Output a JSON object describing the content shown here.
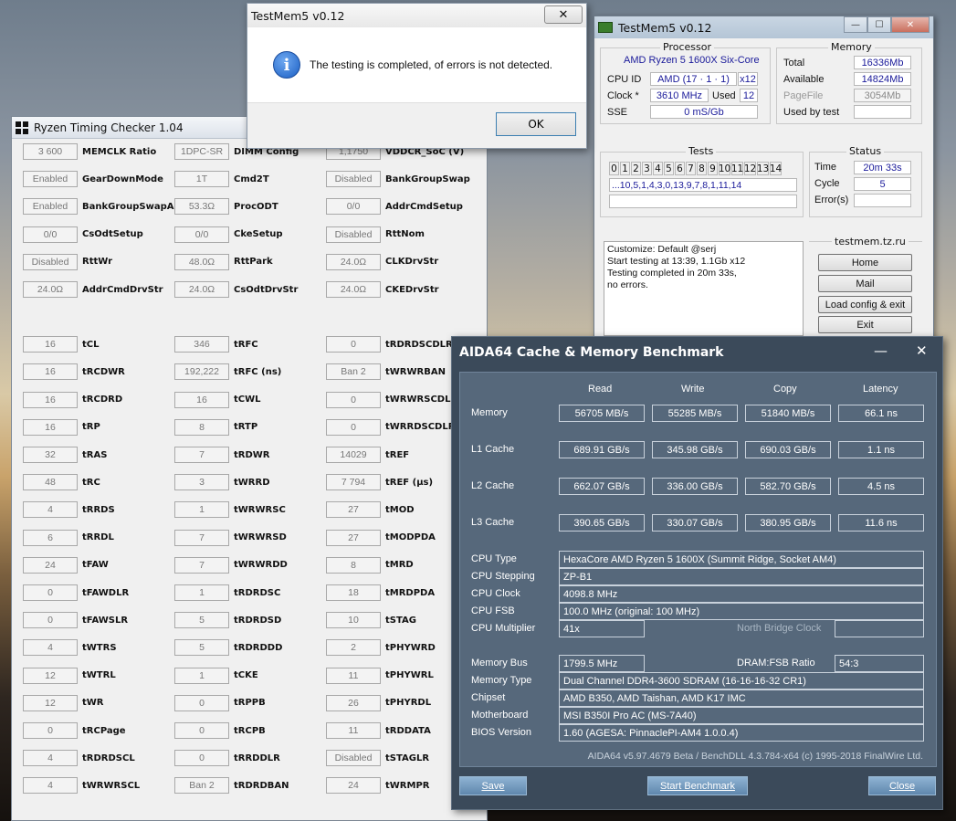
{
  "rtc": {
    "title": "Ryzen Timing Checker 1.04",
    "rows": [
      [
        [
          "3 600",
          "MEMCLK Ratio"
        ],
        [
          "1DPC-SR",
          "DIMM Config"
        ],
        [
          "1,1750",
          "VDDCR_SoC (V)"
        ]
      ],
      [
        [
          "Enabled",
          "GearDownMode"
        ],
        [
          "1T",
          "Cmd2T"
        ],
        [
          "Disabled",
          "BankGroupSwap"
        ]
      ],
      [
        [
          "Enabled",
          "BankGroupSwapAlt"
        ],
        [
          "53.3Ω",
          "ProcODT"
        ],
        [
          "0/0",
          "AddrCmdSetup"
        ]
      ],
      [
        [
          "0/0",
          "CsOdtSetup"
        ],
        [
          "0/0",
          "CkeSetup"
        ],
        [
          "Disabled",
          "RttNom"
        ]
      ],
      [
        [
          "Disabled",
          "RttWr"
        ],
        [
          "48.0Ω",
          "RttPark"
        ],
        [
          "24.0Ω",
          "CLKDrvStr"
        ]
      ],
      [
        [
          "24.0Ω",
          "AddrCmdDrvStr"
        ],
        [
          "24.0Ω",
          "CsOdtDrvStr"
        ],
        [
          "24.0Ω",
          "CKEDrvStr"
        ]
      ],
      [
        [
          "16",
          "tCL"
        ],
        [
          "346",
          "tRFC"
        ],
        [
          "0",
          "tRDRDSCDLR"
        ]
      ],
      [
        [
          "16",
          "tRCDWR"
        ],
        [
          "192,222",
          "tRFC (ns)"
        ],
        [
          "Ban 2",
          "tWRWRBAN"
        ]
      ],
      [
        [
          "16",
          "tRCDRD"
        ],
        [
          "16",
          "tCWL"
        ],
        [
          "0",
          "tWRWRSCDLR"
        ]
      ],
      [
        [
          "16",
          "tRP"
        ],
        [
          "8",
          "tRTP"
        ],
        [
          "0",
          "tWRRDSCDLR"
        ]
      ],
      [
        [
          "32",
          "tRAS"
        ],
        [
          "7",
          "tRDWR"
        ],
        [
          "14029",
          "tREF"
        ]
      ],
      [
        [
          "48",
          "tRC"
        ],
        [
          "3",
          "tWRRD"
        ],
        [
          "7 794",
          "tREF (µs)"
        ]
      ],
      [
        [
          "4",
          "tRRDS"
        ],
        [
          "1",
          "tWRWRSC"
        ],
        [
          "27",
          "tMOD"
        ]
      ],
      [
        [
          "6",
          "tRRDL"
        ],
        [
          "7",
          "tWRWRSD"
        ],
        [
          "27",
          "tMODPDA"
        ]
      ],
      [
        [
          "24",
          "tFAW"
        ],
        [
          "7",
          "tWRWRDD"
        ],
        [
          "8",
          "tMRD"
        ]
      ],
      [
        [
          "0",
          "tFAWDLR"
        ],
        [
          "1",
          "tRDRDSC"
        ],
        [
          "18",
          "tMRDPDA"
        ]
      ],
      [
        [
          "0",
          "tFAWSLR"
        ],
        [
          "5",
          "tRDRDSD"
        ],
        [
          "10",
          "tSTAG"
        ]
      ],
      [
        [
          "4",
          "tWTRS"
        ],
        [
          "5",
          "tRDRDDD"
        ],
        [
          "2",
          "tPHYWRD"
        ]
      ],
      [
        [
          "12",
          "tWTRL"
        ],
        [
          "1",
          "tCKE"
        ],
        [
          "11",
          "tPHYWRL"
        ]
      ],
      [
        [
          "12",
          "tWR"
        ],
        [
          "0",
          "tRPPB"
        ],
        [
          "26",
          "tPHYRDL"
        ]
      ],
      [
        [
          "0",
          "tRCPage"
        ],
        [
          "0",
          "tRCPB"
        ],
        [
          "11",
          "tRDDATA"
        ]
      ],
      [
        [
          "4",
          "tRDRDSCL"
        ],
        [
          "0",
          "tRRDDLR"
        ],
        [
          "Disabled",
          "tSTAGLR"
        ]
      ],
      [
        [
          "4",
          "tWRWRSCL"
        ],
        [
          "Ban 2",
          "tRDRDBAN"
        ],
        [
          "24",
          "tWRMPR"
        ]
      ]
    ]
  },
  "dialog": {
    "title": "TestMem5 v0.12",
    "close": "✕",
    "icon": "i",
    "message": "The testing is completed, of errors is not detected.",
    "ok": "OK"
  },
  "tm": {
    "title": "TestMem5 v0.12",
    "btn_min": "—",
    "btn_max": "☐",
    "btn_close": "✕",
    "processor": {
      "heading": "Processor",
      "name": "AMD Ryzen 5 1600X Six-Core",
      "cpuid_label": "CPU ID",
      "cpuid": "AMD  (17 · 1 · 1)",
      "threads": "x12",
      "clock_label": "Clock *",
      "clock": "3610 MHz",
      "used_label": "Used",
      "used": "12",
      "sse_label": "SSE",
      "sse": "0 mS/Gb"
    },
    "memory": {
      "heading": "Memory",
      "total_label": "Total",
      "total": "16336Mb",
      "avail_label": "Available",
      "avail": "14824Mb",
      "pagefile_label": "PageFile",
      "pagefile": "3054Mb",
      "usedby_label": "Used by test",
      "usedby": ""
    },
    "tests": {
      "heading": "Tests",
      "numbers": [
        "0",
        "1",
        "2",
        "3",
        "4",
        "5",
        "6",
        "7",
        "8",
        "9",
        "10",
        "11",
        "12",
        "13",
        "14"
      ],
      "sequence": "...10,5,1,4,3,0,13,9,7,8,1,11,14"
    },
    "status": {
      "heading": "Status",
      "time_label": "Time",
      "time": "20m 33s",
      "cycle_label": "Cycle",
      "cycle": "5",
      "errors_label": "Error(s)",
      "errors": ""
    },
    "log": [
      "Customize: Default @serj",
      "Start testing at 13:39, 1.1Gb x12",
      "Testing completed in 20m 33s,",
      "no errors."
    ],
    "site": "testmem.tz.ru",
    "buttons": {
      "home": "Home",
      "mail": "Mail",
      "load": "Load config & exit",
      "exit": "Exit"
    }
  },
  "aida": {
    "title": "AIDA64 Cache & Memory Benchmark",
    "min": "—",
    "close": "✕",
    "cols": {
      "read": "Read",
      "write": "Write",
      "copy": "Copy",
      "latency": "Latency"
    },
    "bench": [
      {
        "label": "Memory",
        "read": "56705 MB/s",
        "write": "55285 MB/s",
        "copy": "51840 MB/s",
        "lat": "66.1 ns"
      },
      {
        "label": "L1 Cache",
        "read": "689.91 GB/s",
        "write": "345.98 GB/s",
        "copy": "690.03 GB/s",
        "lat": "1.1 ns"
      },
      {
        "label": "L2 Cache",
        "read": "662.07 GB/s",
        "write": "336.00 GB/s",
        "copy": "582.70 GB/s",
        "lat": "4.5 ns"
      },
      {
        "label": "L3 Cache",
        "read": "390.65 GB/s",
        "write": "330.07 GB/s",
        "copy": "380.95 GB/s",
        "lat": "11.6 ns"
      }
    ],
    "info": {
      "cpu_type_label": "CPU Type",
      "cpu_type": "HexaCore AMD Ryzen 5 1600X  (Summit Ridge, Socket AM4)",
      "cpu_step_label": "CPU Stepping",
      "cpu_step": "ZP-B1",
      "cpu_clock_label": "CPU Clock",
      "cpu_clock": "4098.8 MHz",
      "cpu_fsb_label": "CPU FSB",
      "cpu_fsb": "100.0 MHz  (original: 100 MHz)",
      "cpu_mult_label": "CPU Multiplier",
      "cpu_mult": "41x",
      "nb_clock_label": "North Bridge Clock",
      "nb_clock": "",
      "mem_bus_label": "Memory Bus",
      "mem_bus": "1799.5 MHz",
      "dram_fsb_label": "DRAM:FSB Ratio",
      "dram_fsb": "54:3",
      "mem_type_label": "Memory Type",
      "mem_type": "Dual Channel DDR4-3600 SDRAM  (16-16-16-32 CR1)",
      "chipset_label": "Chipset",
      "chipset": "AMD B350, AMD Taishan, AMD K17 IMC",
      "mobo_label": "Motherboard",
      "mobo": "MSI B350I Pro AC (MS-7A40)",
      "bios_label": "BIOS Version",
      "bios": "1.60  (AGESA: PinnaclePI-AM4 1.0.0.4)"
    },
    "footer": "AIDA64 v5.97.4679 Beta / BenchDLL 4.3.784-x64  (c) 1995-2018 FinalWire Ltd.",
    "buttons": {
      "save": "Save",
      "start": "Start Benchmark",
      "close": "Close"
    }
  }
}
